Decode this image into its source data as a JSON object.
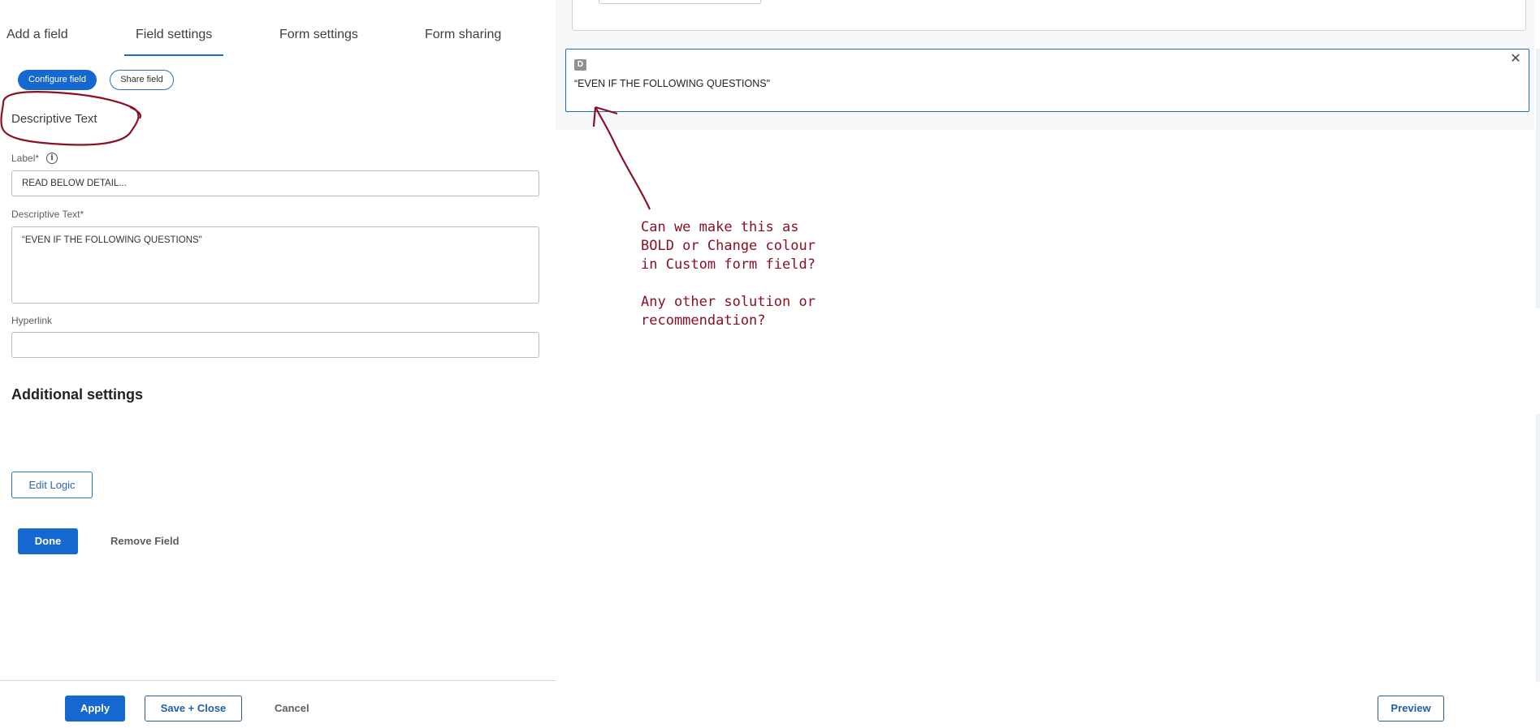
{
  "tabs": [
    {
      "label": "Add a field"
    },
    {
      "label": "Field settings",
      "active": true
    },
    {
      "label": "Form settings"
    },
    {
      "label": "Form sharing"
    }
  ],
  "subtabs": {
    "configure": "Configure field",
    "share": "Share field"
  },
  "field_type_title": "Descriptive Text",
  "label_field": {
    "label": "Label*",
    "value": "READ BELOW DETAIL..."
  },
  "descriptive_text_field": {
    "label": "Descriptive Text*",
    "value": "“EVEN IF THE FOLLOWING QUESTIONS\""
  },
  "hyperlink_field": {
    "label": "Hyperlink",
    "value": ""
  },
  "additional_settings": {
    "heading": "Additional settings",
    "edit_logic_label": "Edit Logic"
  },
  "actions": {
    "done": "Done",
    "remove": "Remove Field"
  },
  "footer": {
    "apply": "Apply",
    "save_close": "Save + Close",
    "cancel": "Cancel",
    "preview": "Preview"
  },
  "canvas": {
    "badge": "D",
    "card_text": "“EVEN IF THE FOLLOWING QUESTIONS\""
  },
  "annotation": {
    "text": "Can we make this as\nBOLD or Change colour\nin Custom form field?\n\nAny other solution or\nrecommendation?",
    "color": "#8b1025"
  },
  "colors": {
    "accent": "#1468d0",
    "selected_border": "#1e6fb8",
    "annotation": "#8b1025"
  }
}
